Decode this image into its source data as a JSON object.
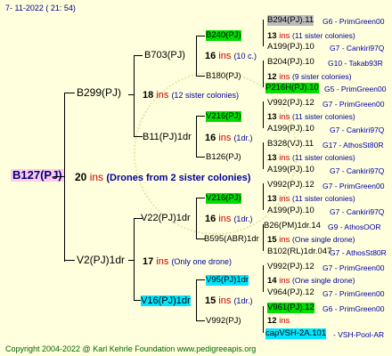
{
  "date": "7-  11-2022  ( 21:  54)",
  "root": {
    "id": "B127(PJ)",
    "num": "20",
    "ins": "ins",
    "note": "(Drones from 2 sister colonies)"
  },
  "sire": {
    "id": "B299(PJ)",
    "num": "18",
    "ins": "ins",
    "note": "(12 sister colonies)"
  },
  "dam": {
    "id": "V2(PJ)1dr",
    "num": "17",
    "ins": "ins",
    "note": "(Only one drone)"
  },
  "g2": {
    "b703": {
      "id": "B703(PJ)",
      "num": "16",
      "ins": "ins",
      "note": "(10 c.)"
    },
    "b11": {
      "id": "B11(PJ)1dr",
      "num": "16",
      "ins": "ins",
      "note": "(1dr.)"
    },
    "v22": {
      "id": "V22(PJ)1dr",
      "num": "16",
      "ins": "ins",
      "note": "(1dr.)"
    },
    "v16": {
      "id": "V16(PJ)1dr",
      "num": "15",
      "ins": "ins",
      "note": "(1dr.)"
    }
  },
  "g3": {
    "b240": {
      "id": "B240(PJ)",
      "num": "13",
      "ins": "ins",
      "note": "(11 sister colonies)"
    },
    "b180": {
      "id": "B180(PJ)",
      "num": "12",
      "ins": "ins",
      "note": "(9 sister colonies)"
    },
    "v216a": {
      "id": "V216(PJ)",
      "num": "13",
      "ins": "ins",
      "note": "(11 sister colonies)"
    },
    "b126": {
      "id": "B126(PJ)",
      "num": "13",
      "ins": "ins",
      "note": "(11 sister colonies)"
    },
    "v216b": {
      "id": "V216(PJ)",
      "num": "13",
      "ins": "ins",
      "note": "(11 sister colonies)"
    },
    "b595": {
      "id": "B595(ABR)1dr",
      "num": "15",
      "ins": "ins",
      "note": "(One single drone)"
    },
    "v95": {
      "id": "V95(PJ)1dr",
      "num": "14",
      "ins": "ins",
      "note": "(One single drone)"
    },
    "v992": {
      "id": "V992(PJ)",
      "num": "12",
      "ins": "ins",
      "note": ""
    }
  },
  "g4": [
    {
      "id": "B294(PJ).11",
      "src": "G6 - PrimGreen00"
    },
    {
      "id": "A199(PJ).10",
      "src": "G7 - Cankiri97Q"
    },
    {
      "id": "B204(PJ).10",
      "src": "G10 - Takab93R"
    },
    {
      "id": "P216H(PJ).10",
      "src": "G5 - PrimGreen00"
    },
    {
      "id": "V992(PJ).12",
      "src": "G7 - PrimGreen00"
    },
    {
      "id": "A199(PJ).10",
      "src": "G7 - Cankiri97Q"
    },
    {
      "id": "B328(VJ).11",
      "src": "G17 - AthosSt80R"
    },
    {
      "id": "A199(PJ).10",
      "src": "G7 - Cankiri97Q"
    },
    {
      "id": "V992(PJ).12",
      "src": "G7 - PrimGreen00"
    },
    {
      "id": "A199(PJ).10",
      "src": "G7 - Cankiri97Q"
    },
    {
      "id": "B26(PM)1dr.14",
      "src": "G9 - AthosOOR"
    },
    {
      "id": "B102(RL)1dr.047",
      "src": "G7 - AthosSt80R"
    },
    {
      "id": "V992(PJ).12",
      "src": "G7 - PrimGreen00"
    },
    {
      "id": "V964(PJ).12",
      "src": "G7 - PrimGreen00"
    },
    {
      "id": "V961(PJ).12",
      "src": "G6 - PrimGreen00"
    },
    {
      "id": "capVSH-2A.101",
      "src": "- VSH-Pool-AR"
    }
  ],
  "footer": "Copyright 2004-2022 @ Karl Kehrle Foundation    www.pedigreeapis.org"
}
